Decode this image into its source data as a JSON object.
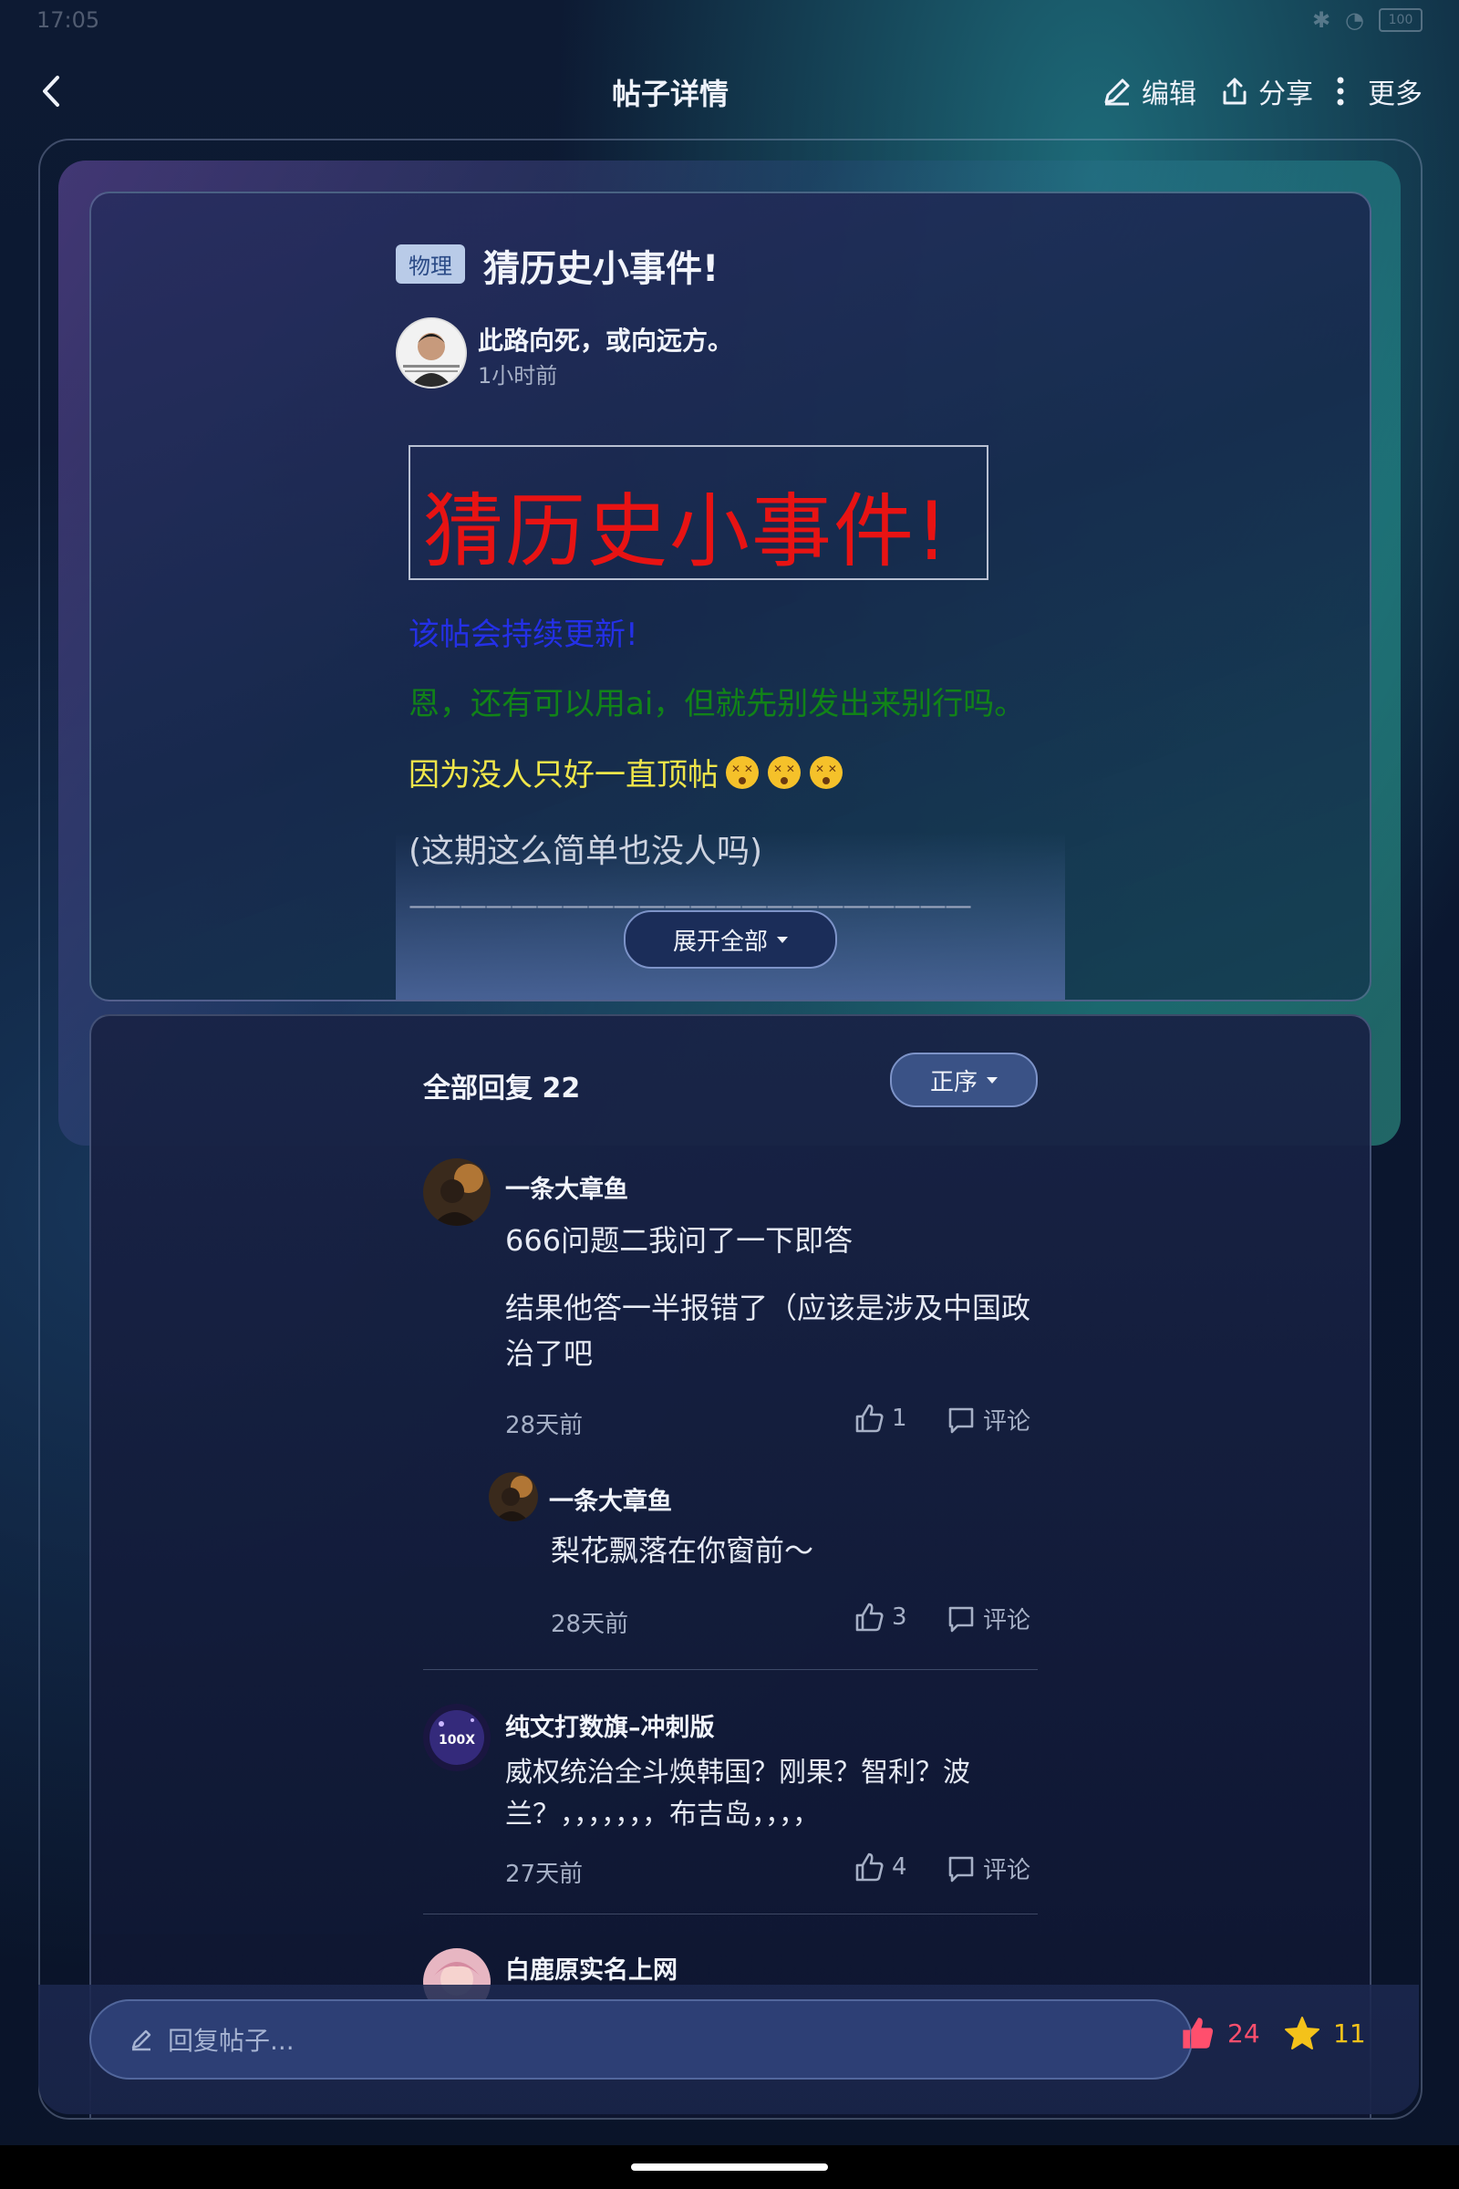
{
  "status_bar": {
    "time": "17:05",
    "battery": "100"
  },
  "header": {
    "title": "帖子详情",
    "edit_label": "编辑",
    "share_label": "分享",
    "more_label": "更多"
  },
  "post": {
    "tag": "物理",
    "title": "猜历史小事件!",
    "author": "此路向死，或向远方。",
    "time": "1小时前",
    "body_big": "猜历史小事件!",
    "line_blue": "该帖会持续更新!",
    "line_green": "恩，还有可以用ai，但就先别发出来别行吗。",
    "line_yellow": "因为没人只好一直顶帖",
    "line_gray": "(这期这么简单也没人吗)",
    "dashes": "——————————————————————",
    "expand_label": "展开全部"
  },
  "replies": {
    "title": "全部回复 22",
    "sort_label": "正序",
    "items": [
      {
        "name": "一条大章鱼",
        "text1": "666问题二我问了一下即答",
        "text2": "结果他答一半报错了（应该是涉及中国政",
        "text3": "治了吧",
        "time": "28天前",
        "likes": "1",
        "comment_label": "评论",
        "sub": {
          "name": "一条大章鱼",
          "text": "梨花飘落在你窗前～",
          "time": "28天前",
          "likes": "3",
          "comment_label": "评论"
        }
      },
      {
        "name": "纯文打数旗–冲刺版",
        "text1": "威权统治全斗焕韩国？刚果？智利？波",
        "text2": "兰？，，，，，，，布吉岛，，，，",
        "time": "27天前",
        "likes": "4",
        "comment_label": "评论"
      },
      {
        "name": "白鹿原实名上网"
      }
    ]
  },
  "bottom_bar": {
    "placeholder": "回复帖子...",
    "likes": "24",
    "favorites": "11"
  },
  "colors": {
    "like": "#ff4f6d",
    "star": "#f4c21a",
    "accent_border": "#7d93c8"
  },
  "icons": [
    "back-icon",
    "edit-icon",
    "share-icon",
    "more-icon",
    "caret-down-icon",
    "thumb-up-icon",
    "comment-icon",
    "pencil-icon",
    "like-filled-icon",
    "star-icon"
  ]
}
